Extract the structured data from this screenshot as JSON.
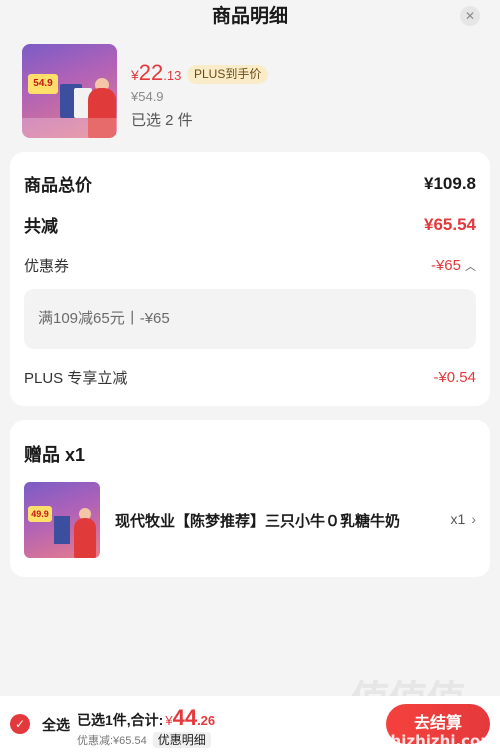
{
  "header": {
    "title": "商品明细"
  },
  "product": {
    "price_yen": "¥",
    "price_int": "22",
    "price_dec": ".13",
    "plus_badge": "PLUS到手价",
    "original_price": "¥54.9",
    "selected": "已选 2 件",
    "thumb_tag": "54.9"
  },
  "summary": {
    "total_label": "商品总价",
    "total_value": "¥109.8",
    "reduce_label": "共减",
    "reduce_value": "¥65.54",
    "coupon_label": "优惠券",
    "coupon_value": "-¥65",
    "coupon_detail": "满109减65元丨-¥65",
    "plus_label": "PLUS 专享立减",
    "plus_value": "-¥0.54"
  },
  "gifts": {
    "title": "赠品 x1",
    "item_name": "现代牧业【陈梦推荐】三只小牛０乳糖牛奶",
    "item_qty": "x1",
    "thumb_tag": "49.9"
  },
  "footer": {
    "select_all": "全选",
    "total_prefix": "已选1件,合计:",
    "total_yen": "¥",
    "total_int": "44",
    "total_dec": ".26",
    "discount_text": "优惠减:¥65.54",
    "detail_label": "优惠明细",
    "checkout_label": "去结算"
  },
  "watermark": {
    "text": "值值值",
    "url": "zhizhizhi.com"
  },
  "colors": {
    "accent": "#e4393c",
    "plus_badge_bg": "#faecc8",
    "background": "#f4f4f4"
  }
}
